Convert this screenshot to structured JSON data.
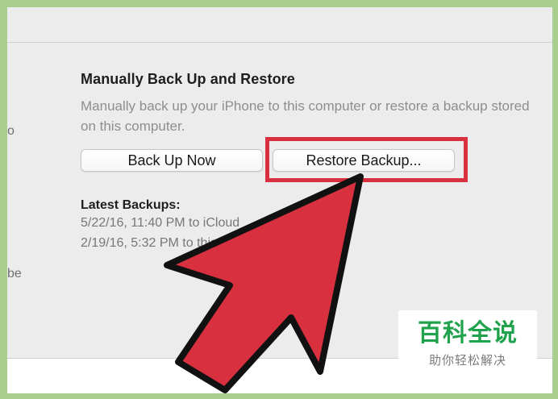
{
  "fragments": {
    "left_o": "o",
    "left_be": "be"
  },
  "section": {
    "heading": "Manually Back Up and Restore",
    "description": "Manually back up your iPhone to this computer or restore a backup stored on this computer."
  },
  "buttons": {
    "back_up_now": "Back Up Now",
    "restore_backup": "Restore Backup..."
  },
  "latest_backups": {
    "label": "Latest Backups:",
    "entries": [
      "5/22/16, 11:40 PM to iCloud",
      "2/19/16, 5:32 PM to this computer"
    ]
  },
  "watermark": {
    "title": "百科全说",
    "subtitle": "助你轻松解决"
  },
  "colors": {
    "frame_green": "#a9cf8e",
    "highlight_red": "#d8303e",
    "arrow_red": "#d8303e",
    "watermark_green": "#21a34d"
  },
  "icons": {
    "annotation_arrow": "red-pointer-arrow-icon"
  }
}
